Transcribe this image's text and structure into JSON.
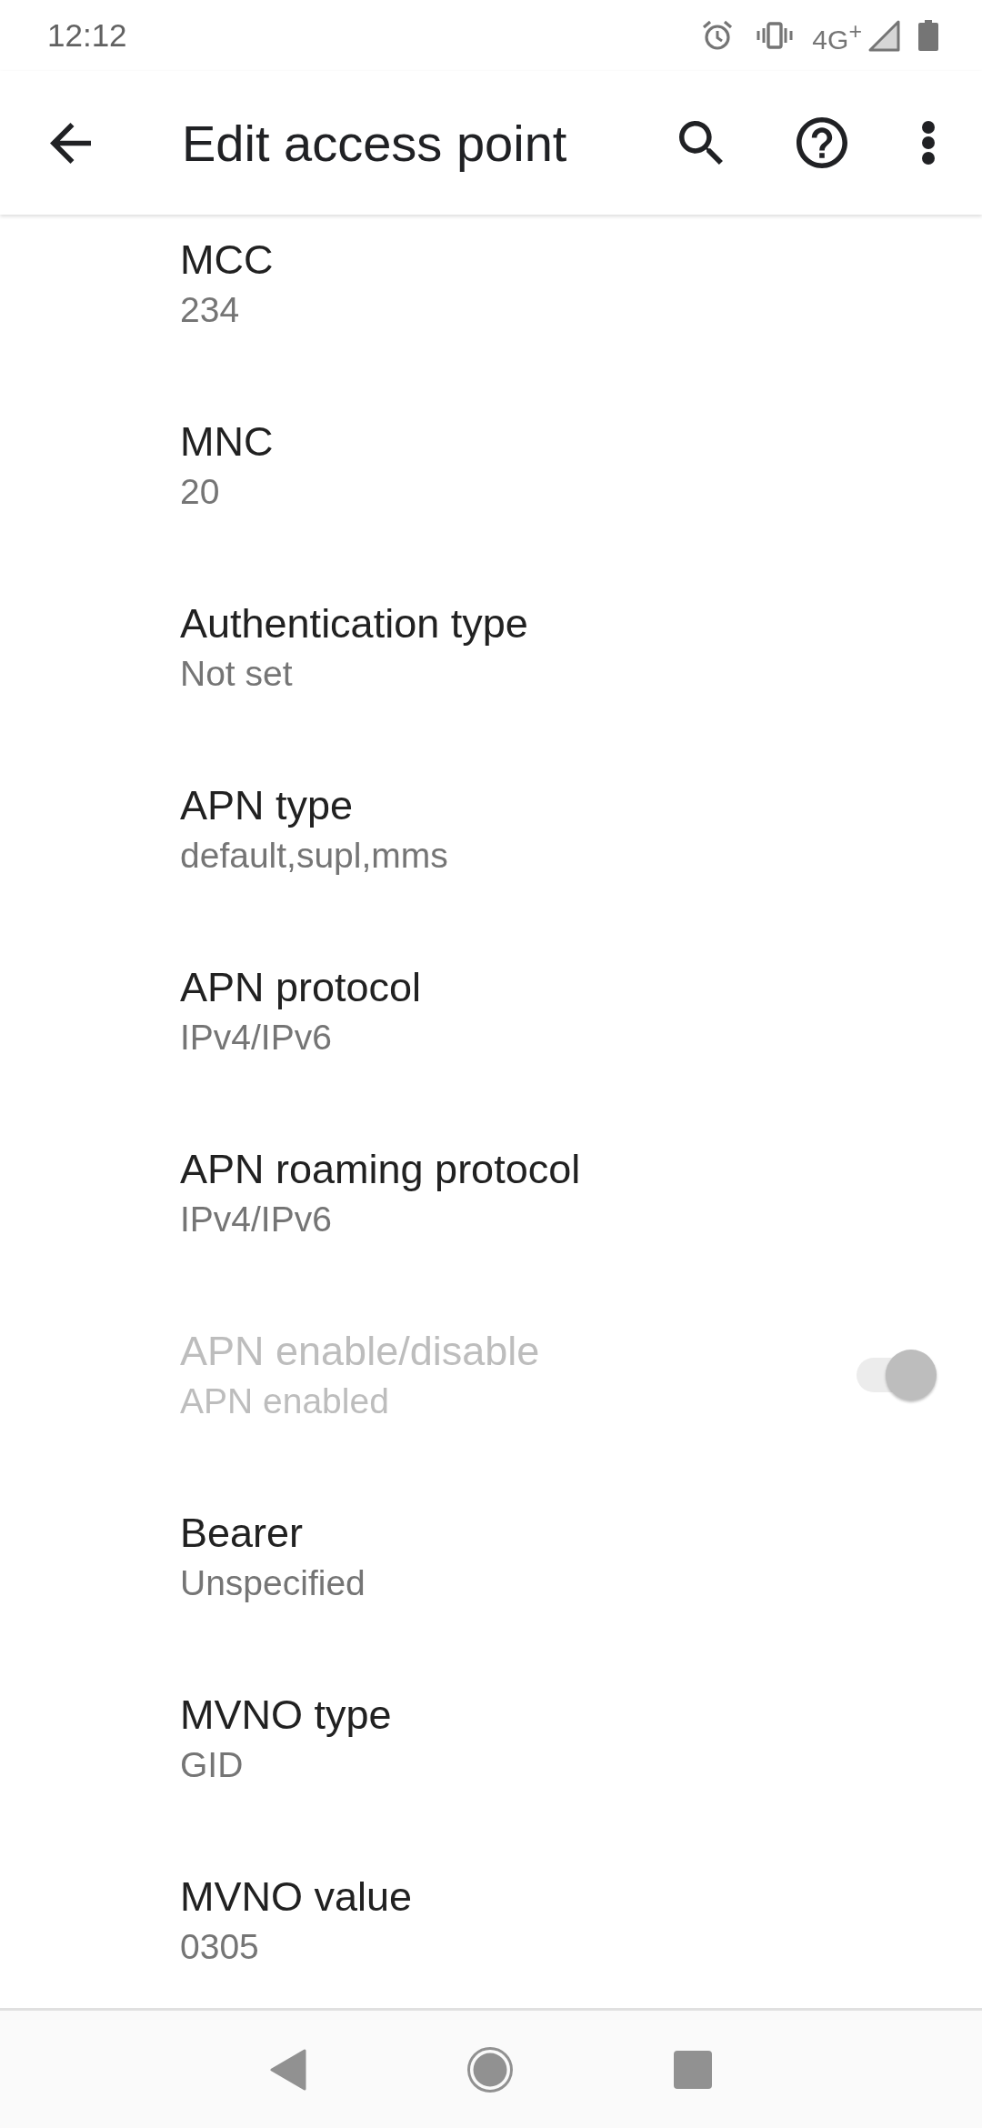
{
  "status_bar": {
    "time": "12:12",
    "network": "4G$^{+}$"
  },
  "toolbar": {
    "title": "Edit access point"
  },
  "items": [
    {
      "kind": "text",
      "title": "MCC",
      "summary": "234",
      "disabled": false
    },
    {
      "kind": "text",
      "title": "MNC",
      "summary": "20",
      "disabled": false
    },
    {
      "kind": "text",
      "title": "Authentication type",
      "summary": "Not set",
      "disabled": false
    },
    {
      "kind": "text",
      "title": "APN type",
      "summary": "default,supl,mms",
      "disabled": false
    },
    {
      "kind": "text",
      "title": "APN protocol",
      "summary": "IPv4/IPv6",
      "disabled": false
    },
    {
      "kind": "text",
      "title": "APN roaming protocol",
      "summary": "IPv4/IPv6",
      "disabled": false
    },
    {
      "kind": "switch",
      "title": "APN enable/disable",
      "summary": "APN enabled",
      "disabled": true,
      "on": true
    },
    {
      "kind": "text",
      "title": "Bearer",
      "summary": "Unspecified",
      "disabled": false
    },
    {
      "kind": "text",
      "title": "MVNO type",
      "summary": "GID",
      "disabled": false
    },
    {
      "kind": "text",
      "title": "MVNO value",
      "summary": "0305",
      "disabled": false
    }
  ]
}
